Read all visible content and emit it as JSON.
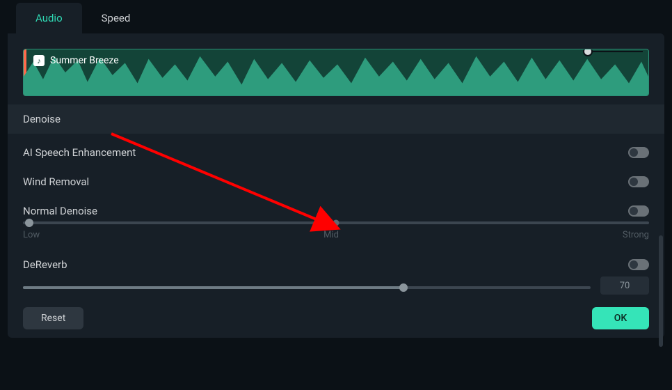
{
  "tabs": {
    "audio": "Audio",
    "speed": "Speed"
  },
  "clip": {
    "title": "Summer Breeze"
  },
  "section": {
    "denoise": "Denoise"
  },
  "controls": {
    "ai_speech": "AI Speech Enhancement",
    "wind_removal": "Wind Removal",
    "normal_denoise": "Normal Denoise",
    "dereverb": "DeReverb"
  },
  "slider_labels": {
    "low": "Low",
    "mid": "Mid",
    "strong": "Strong"
  },
  "dereverb_value": "70",
  "buttons": {
    "reset": "Reset",
    "ok": "OK"
  },
  "toggles": {
    "ai_speech": false,
    "wind_removal": false,
    "normal_denoise": false,
    "dereverb": false
  },
  "colors": {
    "accent": "#35e4b8",
    "active_tab": "#2fd9b4",
    "waveform": "#2e9c7d"
  }
}
